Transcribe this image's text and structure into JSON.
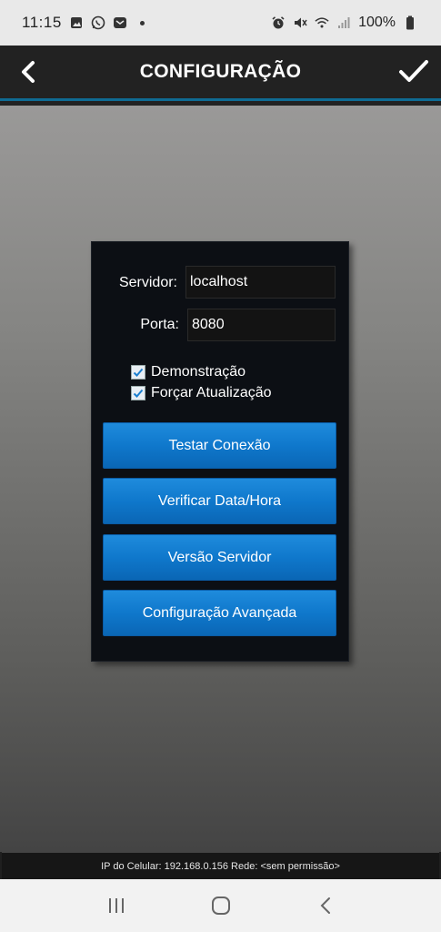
{
  "status_bar": {
    "time": "11:15",
    "battery": "100%",
    "left_icons": [
      "gallery-icon",
      "whatsapp-icon",
      "mail-icon"
    ],
    "right_icons": [
      "alarm-icon",
      "mute-icon",
      "wifi-icon",
      "signal-icon",
      "battery-icon"
    ]
  },
  "app_bar": {
    "title": "CONFIGURAÇÃO",
    "accent": "#0f6b93"
  },
  "form": {
    "server_label": "Servidor:",
    "server_value": "localhost",
    "port_label": "Porta:",
    "port_value": "8080",
    "checkboxes": [
      {
        "label": "Demonstração",
        "checked": true
      },
      {
        "label": "Forçar Atualização",
        "checked": true
      }
    ]
  },
  "buttons": {
    "test_connection": "Testar Conexão",
    "check_datetime": "Verificar Data/Hora",
    "server_version": "Versão Servidor",
    "advanced_config": "Configuração Avançada",
    "color": "#1480d4"
  },
  "footer": {
    "ip_text": "IP do Celular: 192.168.0.156  Rede: <sem permissão>"
  },
  "nav_bar": {
    "items": [
      "recent-apps-icon",
      "home-icon",
      "back-icon"
    ]
  }
}
